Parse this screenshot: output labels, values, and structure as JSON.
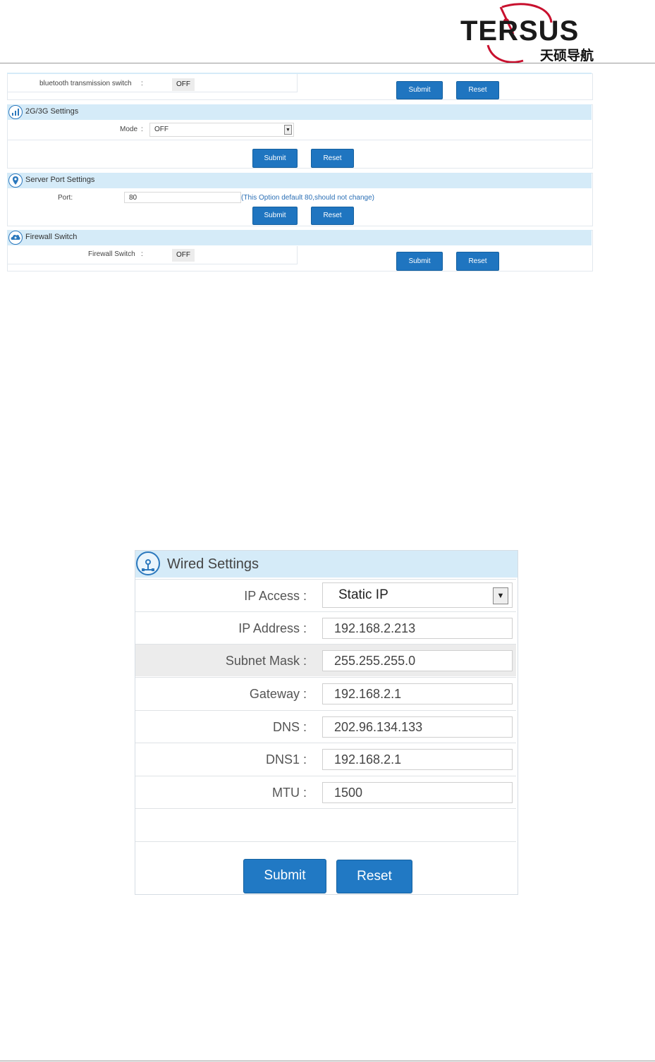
{
  "brand": {
    "name": "TERSUS",
    "name_cn": "天硕导航"
  },
  "bluetooth": {
    "label": "bluetooth transmission switch",
    "colon": ":",
    "value": "OFF",
    "submit": "Submit",
    "reset": "Reset"
  },
  "cellular": {
    "title": "2G/3G Settings",
    "mode_label": "Mode",
    "colon": ":",
    "mode_value": "OFF",
    "submit": "Submit",
    "reset": "Reset"
  },
  "server_port": {
    "title": "Server Port Settings",
    "port_label": "Port:",
    "port_value": "80",
    "note": "(This Option default 80,should not change)",
    "submit": "Submit",
    "reset": "Reset"
  },
  "firewall": {
    "title": "Firewall Switch",
    "label": "Firewall Switch",
    "colon": ":",
    "value": "OFF",
    "submit": "Submit",
    "reset": "Reset"
  },
  "wired": {
    "title": "Wired Settings",
    "colon": ":",
    "rows": [
      {
        "label": "IP Access",
        "value": "Static IP"
      },
      {
        "label": "IP Address",
        "value": "192.168.2.213"
      },
      {
        "label": "Subnet Mask",
        "value": "255.255.255.0"
      },
      {
        "label": "Gateway",
        "value": "192.168.2.1"
      },
      {
        "label": "DNS",
        "value": "202.96.134.133"
      },
      {
        "label": "DNS1",
        "value": "192.168.2.1"
      },
      {
        "label": "MTU",
        "value": "1500"
      }
    ],
    "submit": "Submit",
    "reset": "Reset"
  }
}
